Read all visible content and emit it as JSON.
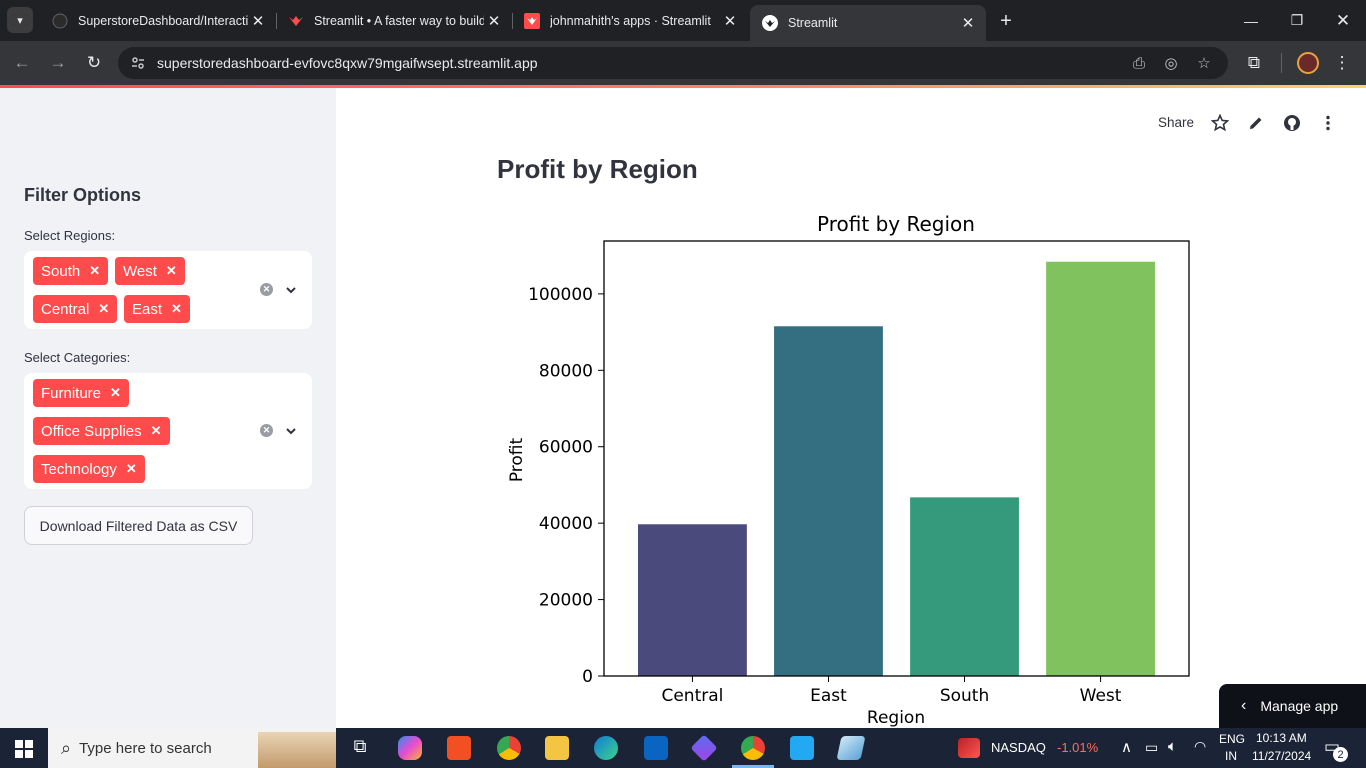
{
  "browser": {
    "tabs": [
      {
        "title": "SuperstoreDashboard/Interactiv",
        "icon": "github-icon"
      },
      {
        "title": "Streamlit • A faster way to build",
        "icon": "streamlit-icon"
      },
      {
        "title": "johnmahith's apps · Streamlit",
        "icon": "streamlit-icon"
      },
      {
        "title": "Streamlit",
        "icon": "streamlit-icon"
      }
    ],
    "url": "superstoredashboard-evfovc8qxw79mgaifwsept.streamlit.app"
  },
  "sidebar": {
    "title": "Filter Options",
    "regions_label": "Select Regions:",
    "regions": [
      "South",
      "West",
      "Central",
      "East"
    ],
    "categories_label": "Select Categories:",
    "categories": [
      "Furniture",
      "Office Supplies",
      "Technology"
    ],
    "download_label": "Download Filtered Data as CSV"
  },
  "toolbar": {
    "share_label": "Share"
  },
  "main": {
    "heading": "Profit by Region"
  },
  "chart_data": {
    "type": "bar",
    "title": "Profit by Region",
    "xlabel": "Region",
    "ylabel": "Profit",
    "categories": [
      "Central",
      "East",
      "South",
      "West"
    ],
    "values": [
      39706,
      91523,
      46750,
      108418
    ],
    "colors": [
      "#482173",
      "#2e6f8e",
      "#29af7f",
      "#bddf26"
    ],
    "bar_colors": [
      "#4a4a7c",
      "#336f80",
      "#349a7b",
      "#80c35e"
    ],
    "yticks": [
      0,
      20000,
      40000,
      60000,
      80000,
      100000
    ],
    "ylim": [
      0,
      113840
    ],
    "grid": false
  },
  "manage_app": {
    "label": "Manage app"
  },
  "taskbar": {
    "search_placeholder": "Type here to search",
    "ticker_name": "NASDAQ",
    "ticker_change": "-1.01%",
    "lang_top": "ENG",
    "lang_bottom": "IN",
    "time": "10:13 AM",
    "date": "11/27/2024",
    "notifications": "2"
  }
}
